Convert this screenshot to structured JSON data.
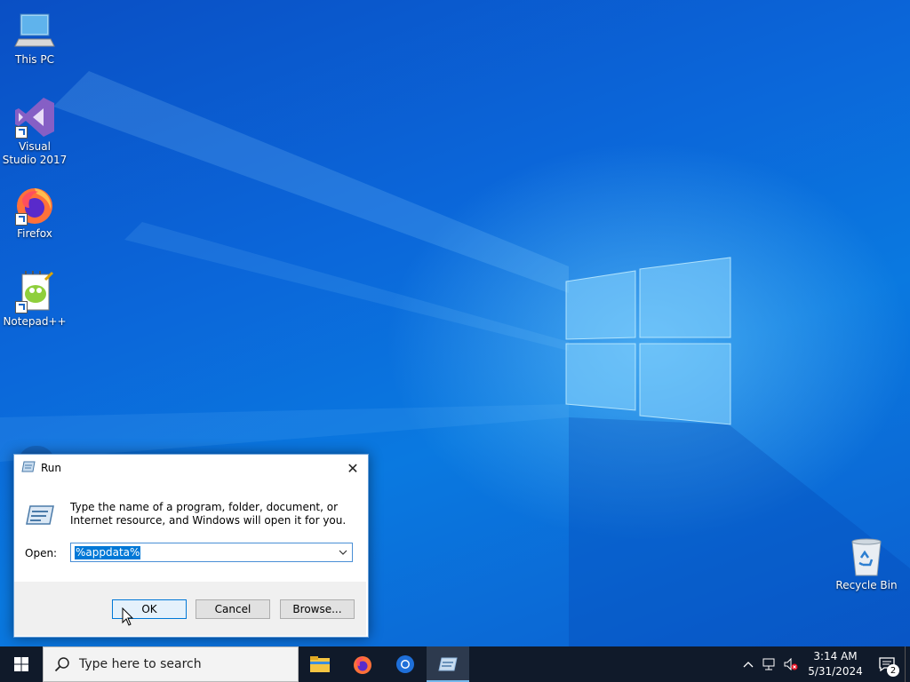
{
  "desktop": {
    "icons": [
      {
        "label": "This PC",
        "icon": "this-pc-icon"
      },
      {
        "label": "Visual Studio 2017",
        "icon": "visual-studio-icon"
      },
      {
        "label": "Firefox",
        "icon": "firefox-icon"
      },
      {
        "label": "Notepad++",
        "icon": "notepadpp-icon"
      },
      {
        "label": "Recycle Bin",
        "icon": "recycle-bin-icon"
      }
    ]
  },
  "run_dialog": {
    "title": "Run",
    "description": "Type the name of a program, folder, document, or Internet resource, and Windows will open it for you.",
    "open_label": "Open:",
    "open_value": "%appdata%",
    "ok_label": "OK",
    "cancel_label": "Cancel",
    "browse_label": "Browse..."
  },
  "taskbar": {
    "search_placeholder": "Type here to search",
    "apps": [
      "file-explorer-icon",
      "firefox-icon",
      "chrome-icon",
      "run-icon"
    ],
    "clock_time": "3:14 AM",
    "clock_date": "5/31/2024",
    "notification_count": "2"
  },
  "colors": {
    "accent": "#0078d7",
    "taskbar": "#101a2a"
  }
}
